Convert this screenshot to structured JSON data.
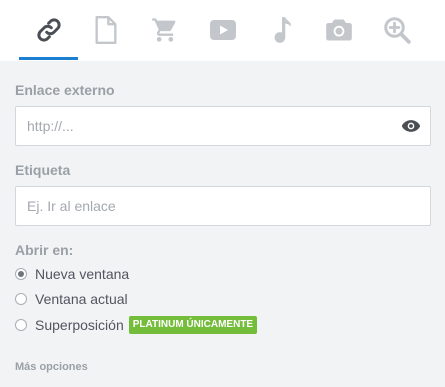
{
  "tabs": [
    {
      "icon": "link-icon",
      "active": true
    },
    {
      "icon": "file-icon",
      "active": false
    },
    {
      "icon": "cart-icon",
      "active": false
    },
    {
      "icon": "youtube-icon",
      "active": false
    },
    {
      "icon": "music-note-icon",
      "active": false
    },
    {
      "icon": "camera-icon",
      "active": false
    },
    {
      "icon": "zoom-in-icon",
      "active": false
    }
  ],
  "colors": {
    "accent": "#1d7fd1",
    "badge": "#74bd3a",
    "icon_inactive": "#c3c7cb",
    "icon_active": "#4a4f56"
  },
  "external_link": {
    "label": "Enlace externo",
    "placeholder": "http://...",
    "value": "",
    "toggle_icon": "eye-icon"
  },
  "tag": {
    "label": "Etiqueta",
    "placeholder": "Ej. Ir al enlace",
    "value": ""
  },
  "open_in": {
    "label": "Abrir en:",
    "options": [
      {
        "label": "Nueva ventana",
        "checked": true
      },
      {
        "label": "Ventana actual",
        "checked": false
      },
      {
        "label": "Superposición",
        "checked": false,
        "badge": "PLATINUM ÚNICAMENTE"
      }
    ]
  },
  "more_options": "Más opciones"
}
